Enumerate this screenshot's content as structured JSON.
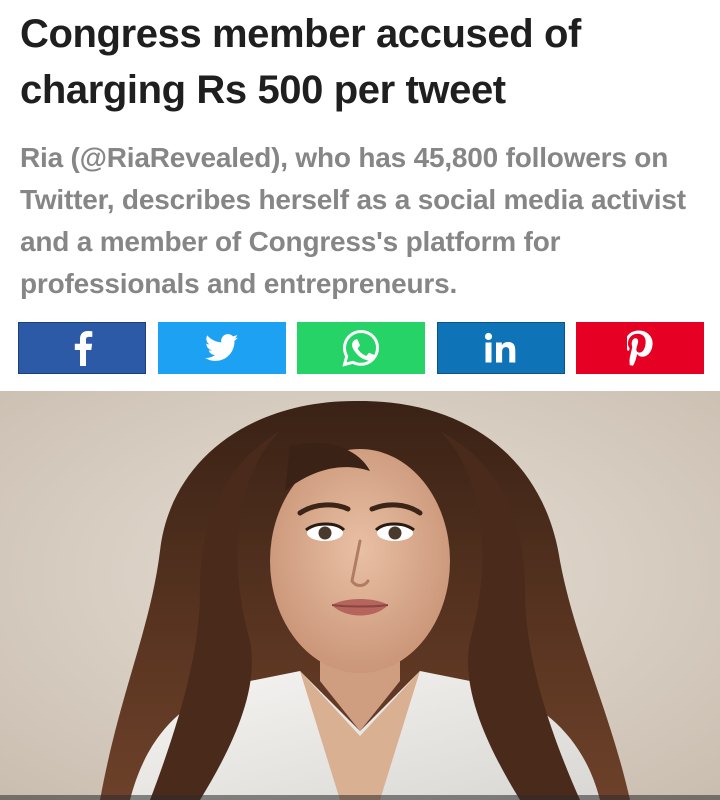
{
  "article": {
    "headline": "Congress member accused of charging Rs 500 per tweet",
    "summary": "Ria (@RiaRevealed), who has 45,800 followers on Twitter, describes herself as a social media activist and a member of Congress's platform for professionals and entrepreneurs."
  },
  "share_buttons": [
    {
      "network": "facebook",
      "icon": "facebook-icon",
      "color": "#2d5aa6"
    },
    {
      "network": "twitter",
      "icon": "twitter-icon",
      "color": "#1da1f2"
    },
    {
      "network": "whatsapp",
      "icon": "whatsapp-icon",
      "color": "#25d366"
    },
    {
      "network": "linkedin",
      "icon": "linkedin-icon",
      "color": "#0f74b7"
    },
    {
      "network": "pinterest",
      "icon": "pinterest-icon",
      "color": "#e60023"
    }
  ],
  "colors": {
    "headline": "#1f1f1f",
    "summary": "#868686",
    "photo_background": "#d8cfc4"
  }
}
